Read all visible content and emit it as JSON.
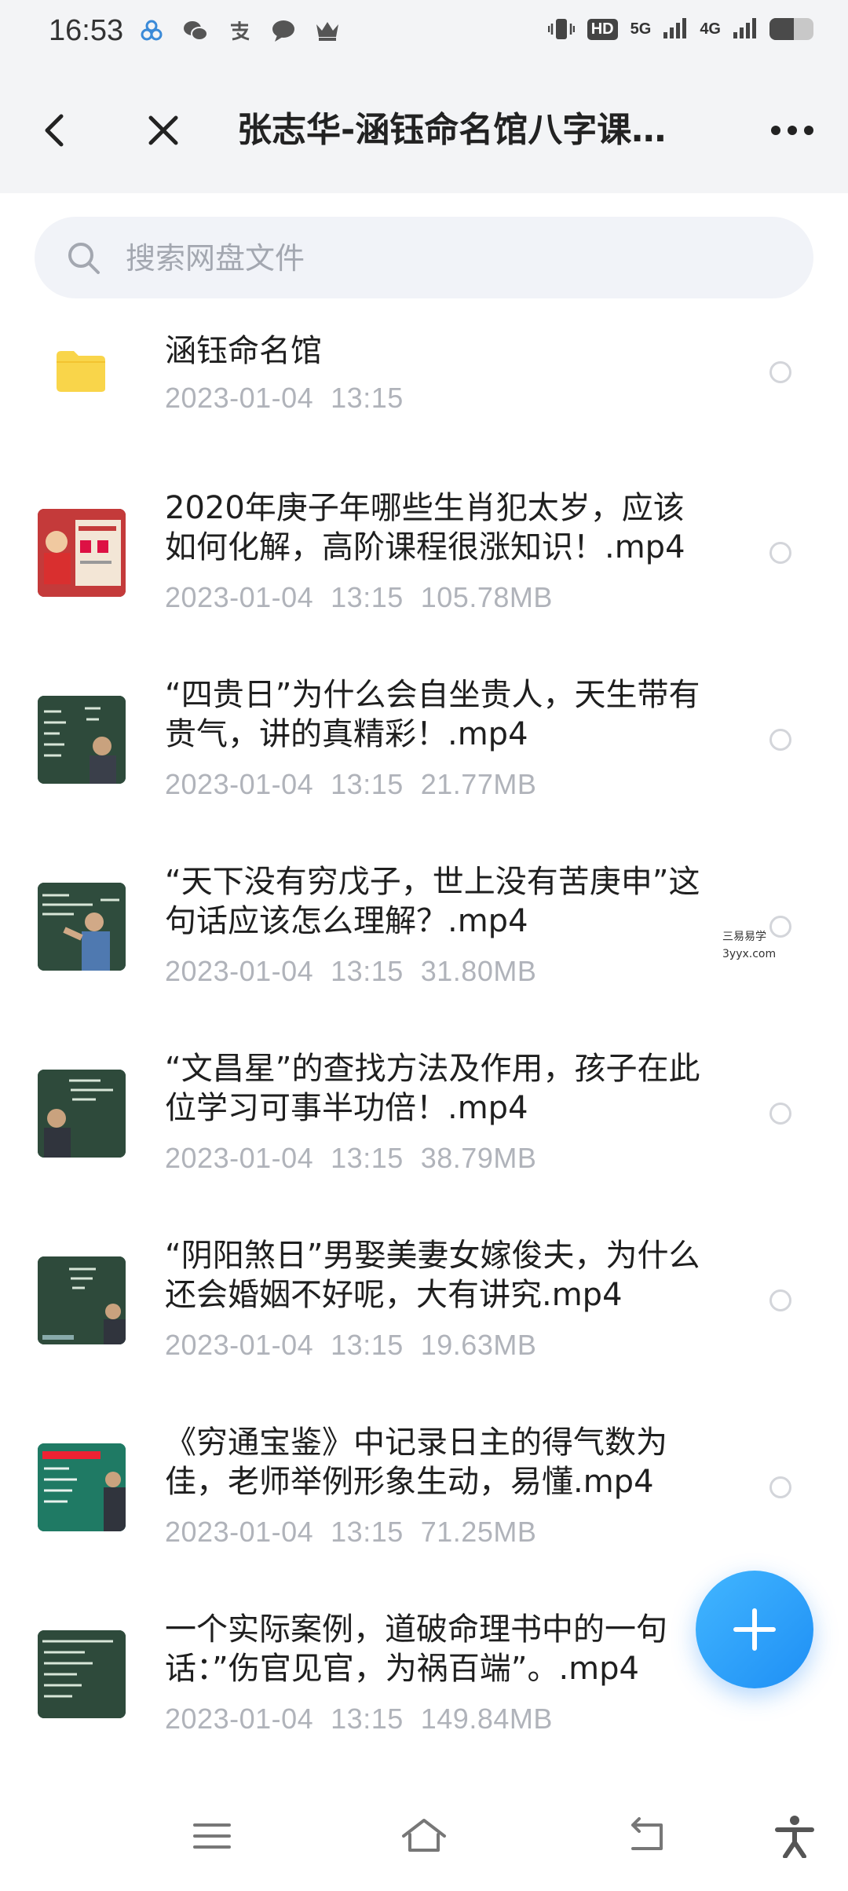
{
  "status_bar": {
    "time": "16:53",
    "left_icons": [
      "cloud-icon",
      "wechat-icon",
      "alipay-icon",
      "chat-bubble-icon",
      "crown-icon"
    ],
    "hd_label": "HD",
    "signal_5g": "5G",
    "signal_4g": "4G",
    "battery_level": 0.55
  },
  "nav": {
    "title": "张志华-涵钰命名馆八字课…"
  },
  "search": {
    "placeholder": "搜索网盘文件"
  },
  "files": [
    {
      "name": "涵钰命名馆",
      "date": "2023-01-04",
      "time": "13:15",
      "size": "",
      "type": "folder"
    },
    {
      "name": "2020年庚子年哪些生肖犯太岁，应该如何化解，高阶课程很涨知识！.mp4",
      "date": "2023-01-04",
      "time": "13:15",
      "size": "105.78MB",
      "type": "video"
    },
    {
      "name": "“四贵日”为什么会自坐贵人，天生带有贵气，讲的真精彩！.mp4",
      "date": "2023-01-04",
      "time": "13:15",
      "size": "21.77MB",
      "type": "video"
    },
    {
      "name": "“天下没有穷戊子，世上没有苦庚申”这句话应该怎么理解？.mp4",
      "date": "2023-01-04",
      "time": "13:15",
      "size": "31.80MB",
      "type": "video"
    },
    {
      "name": "“文昌星”的查找方法及作用，孩子在此位学习可事半功倍！.mp4",
      "date": "2023-01-04",
      "time": "13:15",
      "size": "38.79MB",
      "type": "video"
    },
    {
      "name": "“阴阳煞日”男娶美妻女嫁俊夫，为什么还会婚姻不好呢，大有讲究.mp4",
      "date": "2023-01-04",
      "time": "13:15",
      "size": "19.63MB",
      "type": "video"
    },
    {
      "name": "《穷通宝鉴》中记录日主的得气数为佳，老师举例形象生动，易懂.mp4",
      "date": "2023-01-04",
      "time": "13:15",
      "size": "71.25MB",
      "type": "video"
    },
    {
      "name": "一个实际案例，道破命理书中的一句话：”伤官见官，为祸百端”。.mp4",
      "date": "2023-01-04",
      "time": "13:15",
      "size": "149.84MB",
      "type": "video"
    }
  ],
  "watermark": {
    "line1": "三易易学",
    "line2": "3yyx.com"
  },
  "colors": {
    "accent": "#1e8ff5",
    "folder": "#f9d54a",
    "meta_text": "#b0b3ba",
    "chalkboard": "#2e4a3b"
  }
}
